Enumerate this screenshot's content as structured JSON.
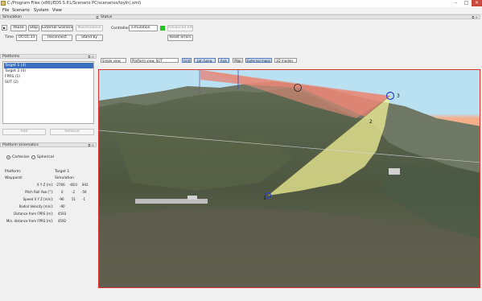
{
  "window": {
    "title": "C:/Program Files (x86)/EDS S.P.L/Scenario PC/scenarios/toyln(.xml)"
  },
  "menu": [
    "File",
    "Scenario",
    "System",
    "View"
  ],
  "simulation": {
    "header": "Simulation",
    "buttons": [
      "Pause",
      "Stop",
      "External Scenario",
      "Maintenance"
    ],
    "time_label": "Time",
    "time_value": "00:01:33",
    "reconnect": "Reconnect",
    "stand_by": "Stand by"
  },
  "status": {
    "header": "Status",
    "controller_label": "Controller",
    "controller_value": "simulation",
    "advanced_info": "Advanced Info",
    "reset_errors": "Reset errors",
    "indicator_color": "#22c322"
  },
  "platforms": {
    "header": "Platforms",
    "items": [
      "Target 1 (3)",
      "Target 2 (4)",
      "FPRS (1)",
      "SUT (2)"
    ],
    "selected_index": 0,
    "add": "Add",
    "remove": "Remove"
  },
  "kinematics": {
    "header": "Platform kinematics",
    "coord_options": [
      "Cartesian",
      "Spherical"
    ],
    "selected_coord": "Cartesian",
    "platform_label": "Platform:",
    "platform_value": "Target 1",
    "waypoint_label": "Waypoint:",
    "waypoint_value": "Simulation",
    "rows": [
      {
        "label": "X Y Z [m]:",
        "values": [
          "-2766",
          "-60/1",
          "842"
        ]
      },
      {
        "label": "Pitch Roll Yaw [°]:",
        "values": [
          "0",
          "-2",
          "-59"
        ]
      },
      {
        "label": "Speed X Y Z [m/s]:",
        "values": [
          "-96",
          "51",
          "-1"
        ]
      },
      {
        "label": "Radial Velocity [m/s]:",
        "values": [
          "-90"
        ]
      },
      {
        "label": "Distance from FPRS [m]:",
        "values": [
          "4593"
        ]
      },
      {
        "label": "Min. distance from FPRS [m]:",
        "values": [
          "4592"
        ]
      }
    ]
  },
  "toolbar": {
    "single_view": "Single view",
    "platform_view": "Platform view: SUT",
    "buttons": [
      "Grid",
      "Lat./Long.",
      "Axis",
      "Map",
      "External maps"
    ],
    "models": "3D models"
  },
  "scene": {
    "markers": [
      "1",
      "2",
      "3"
    ],
    "colors": {
      "sky": "#b9e1f2",
      "horizon": "#f4b08c",
      "beam_red": "#e77d6f",
      "beam_yellow": "#f1f095",
      "marker": "#2a3fc4"
    }
  }
}
